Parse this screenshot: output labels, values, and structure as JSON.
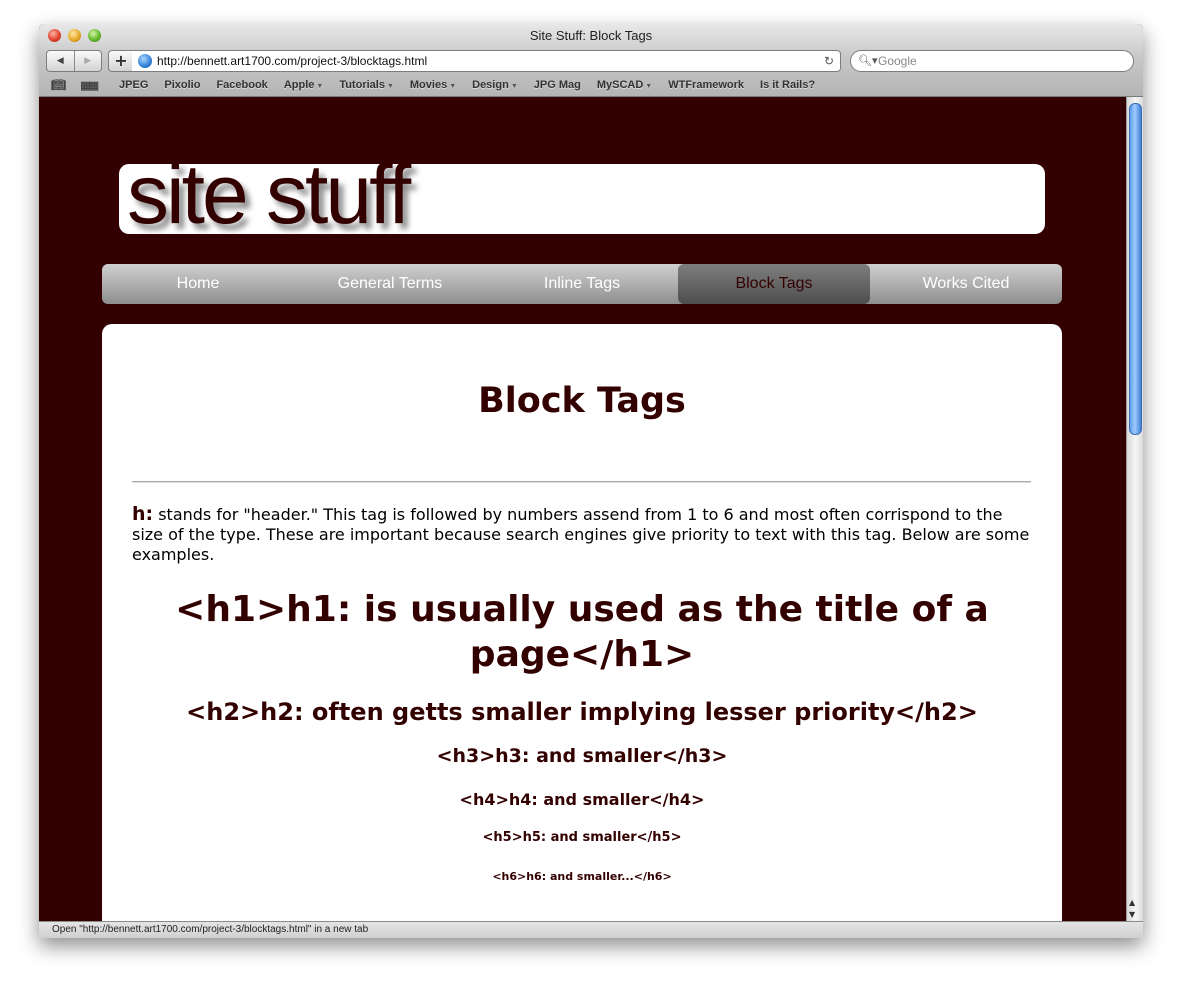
{
  "window": {
    "title": "Site Stuff: Block Tags"
  },
  "toolbar": {
    "back_icon": "back-arrow-icon",
    "forward_icon": "forward-arrow-icon",
    "add_label": "+",
    "url": "http://bennett.art1700.com/project-3/blocktags.html",
    "reload_glyph": "↻",
    "search_placeholder": "Google"
  },
  "bookmarks": [
    {
      "label": "JPEG",
      "menu": false
    },
    {
      "label": "Pixolio",
      "menu": false
    },
    {
      "label": "Facebook",
      "menu": false
    },
    {
      "label": "Apple",
      "menu": true
    },
    {
      "label": "Tutorials",
      "menu": true
    },
    {
      "label": "Movies",
      "menu": true
    },
    {
      "label": "Design",
      "menu": true
    },
    {
      "label": "JPG Mag",
      "menu": false
    },
    {
      "label": "MySCAD",
      "menu": true
    },
    {
      "label": "WTFramework",
      "menu": false
    },
    {
      "label": "Is it Rails?",
      "menu": false
    }
  ],
  "site": {
    "banner": "site stuff",
    "nav": [
      "Home",
      "General Terms",
      "Inline Tags",
      "Block Tags",
      "Works Cited"
    ],
    "active_nav": "Block Tags",
    "heading": "Block Tags",
    "intro_term": "h:",
    "intro_text": " stands for \"header.\" This tag is followed by numbers assend from 1 to 6 and most often corrispond to the size of the type. These are important because search engines give priority to text with this tag. Below are some examples.",
    "examples": {
      "h1": "<h1>h1: is usually used as the title of a page</h1>",
      "h2": "<h2>h2: often getts smaller implying lesser priority</h2>",
      "h3": "<h3>h3: and smaller</h3>",
      "h4": "<h4>h4: and smaller</h4>",
      "h5": "<h5>h5: and smaller</h5>",
      "h6": "<h6>h6: and smaller...</h6>"
    }
  },
  "status": {
    "text": "Open \"http://bennett.art1700.com/project-3/blocktags.html\" in a new tab"
  },
  "colors": {
    "site_background": "#320000",
    "heading_color": "#330000"
  }
}
